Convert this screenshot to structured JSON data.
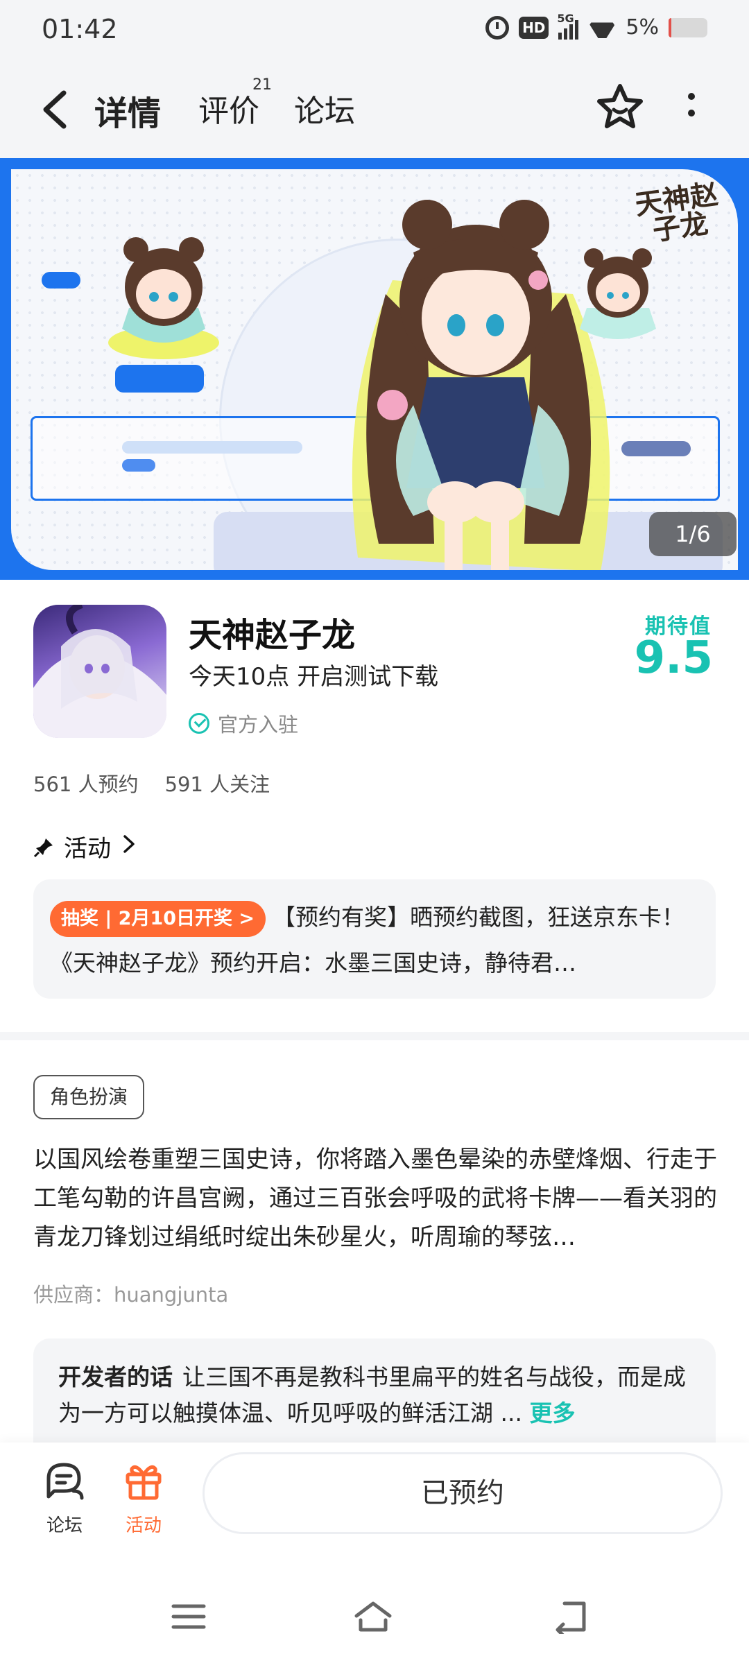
{
  "status_bar": {
    "time": "01:42",
    "battery_percent": "5%",
    "network": "5G",
    "hd_label": "HD"
  },
  "nav": {
    "tabs": [
      {
        "label": "详情",
        "active": true
      },
      {
        "label": "评价",
        "badge": "21"
      },
      {
        "label": "论坛"
      }
    ]
  },
  "banner": {
    "logo_text": "天神赵子龙",
    "counter": "1/6"
  },
  "game": {
    "title": "天神赵子龙",
    "subtitle": "今天10点 开启测试下载",
    "official": "官方入驻",
    "expect_label": "期待值",
    "expect_value": "9.5",
    "reservations": "561 人预约",
    "followers": "591 人关注"
  },
  "activity": {
    "heading": "活动",
    "tag": "抽奖 | 2月10日开奖 >",
    "text": "【预约有奖】晒预约截图，狂送京东卡！《天神赵子龙》预约开启：水墨三国史诗，静待君…"
  },
  "details": {
    "genre": "角色扮演",
    "description": "以国风绘卷重塑三国史诗，你将踏入墨色晕染的赤壁烽烟、行走于工笔勾勒的许昌宫阙，通过三百张会呼吸的武将卡牌——看关羽的青龙刀锋划过绢纸时绽出朱砂星火，听周瑜的琴弦…",
    "supplier": "供应商：huangjunta"
  },
  "developer": {
    "title": "开发者的话",
    "text": "让三国不再是教科书里扁平的姓名与战役，而是成为一方可以触摸体温、听见呼吸的鲜活江湖 ...",
    "more": "更多"
  },
  "bottom_bar": {
    "forum_label": "论坛",
    "activity_label": "活动",
    "reserve_label": "已预约"
  },
  "colors": {
    "accent": "#19c2b2",
    "orange": "#ff6a33",
    "banner_blue": "#1d74ee"
  }
}
